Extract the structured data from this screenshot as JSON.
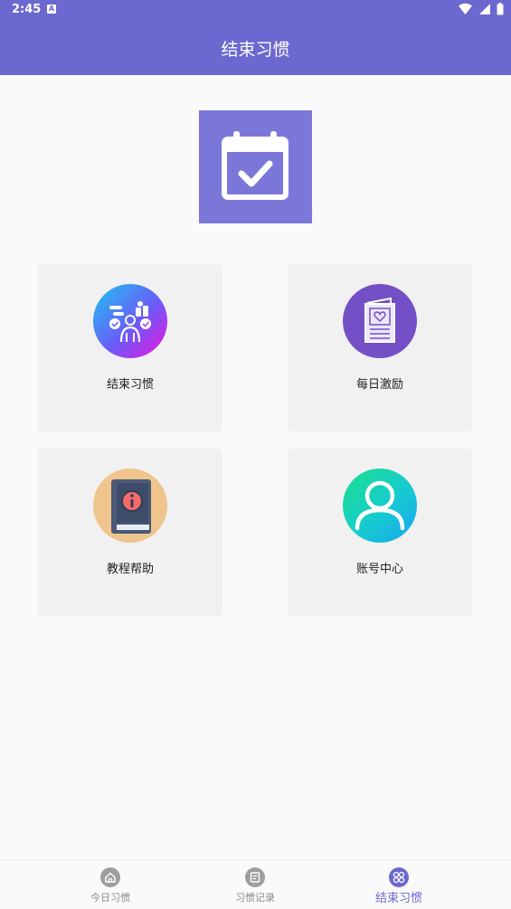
{
  "status": {
    "time": "2:45",
    "notification_icon": "a-icon"
  },
  "appbar": {
    "title": "结束习惯"
  },
  "hero": {
    "icon": "calendar-check-icon",
    "bg_color": "#7b77d9"
  },
  "cards": [
    {
      "label": "结束习惯",
      "icon": "habit-people-icon"
    },
    {
      "label": "每日激励",
      "icon": "heart-letter-icon"
    },
    {
      "label": "教程帮助",
      "icon": "info-book-icon"
    },
    {
      "label": "账号中心",
      "icon": "user-icon"
    }
  ],
  "bottom_nav": [
    {
      "label": "今日习惯",
      "icon": "home-icon",
      "active": false
    },
    {
      "label": "习惯记录",
      "icon": "record-icon",
      "active": false
    },
    {
      "label": "结束习惯",
      "icon": "grid-icon",
      "active": true
    }
  ],
  "colors": {
    "primary": "#6b68cf",
    "inactive": "#8a8a8a",
    "card_bg": "#f1f1f1"
  }
}
